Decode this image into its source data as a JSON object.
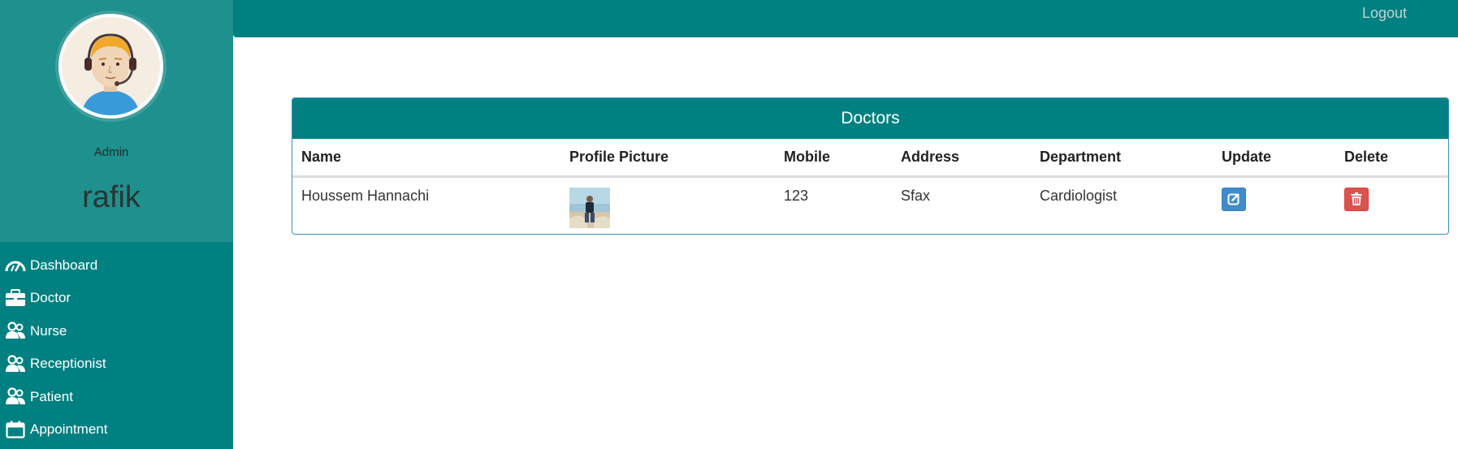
{
  "sidebar": {
    "role": "Admin",
    "username": "rafik",
    "items": [
      {
        "label": "Dashboard",
        "icon": "dashboard-icon"
      },
      {
        "label": "Doctor",
        "icon": "briefcase-icon"
      },
      {
        "label": "Nurse",
        "icon": "users-icon"
      },
      {
        "label": "Receptionist",
        "icon": "users-icon"
      },
      {
        "label": "Patient",
        "icon": "users-icon"
      },
      {
        "label": "Appointment",
        "icon": "calendar-icon"
      }
    ]
  },
  "topbar": {
    "logout_label": "Logout"
  },
  "panel": {
    "title": "Doctors",
    "columns": [
      "Name",
      "Profile Picture",
      "Mobile",
      "Address",
      "Department",
      "Update",
      "Delete"
    ],
    "rows": [
      {
        "name": "Houssem Hannachi",
        "mobile": "123",
        "address": "Sfax",
        "department": "Cardiologist"
      }
    ]
  },
  "colors": {
    "primary": "#008080",
    "profile_bg": "#1e908e",
    "update": "#428bca",
    "delete": "#d9534f"
  }
}
